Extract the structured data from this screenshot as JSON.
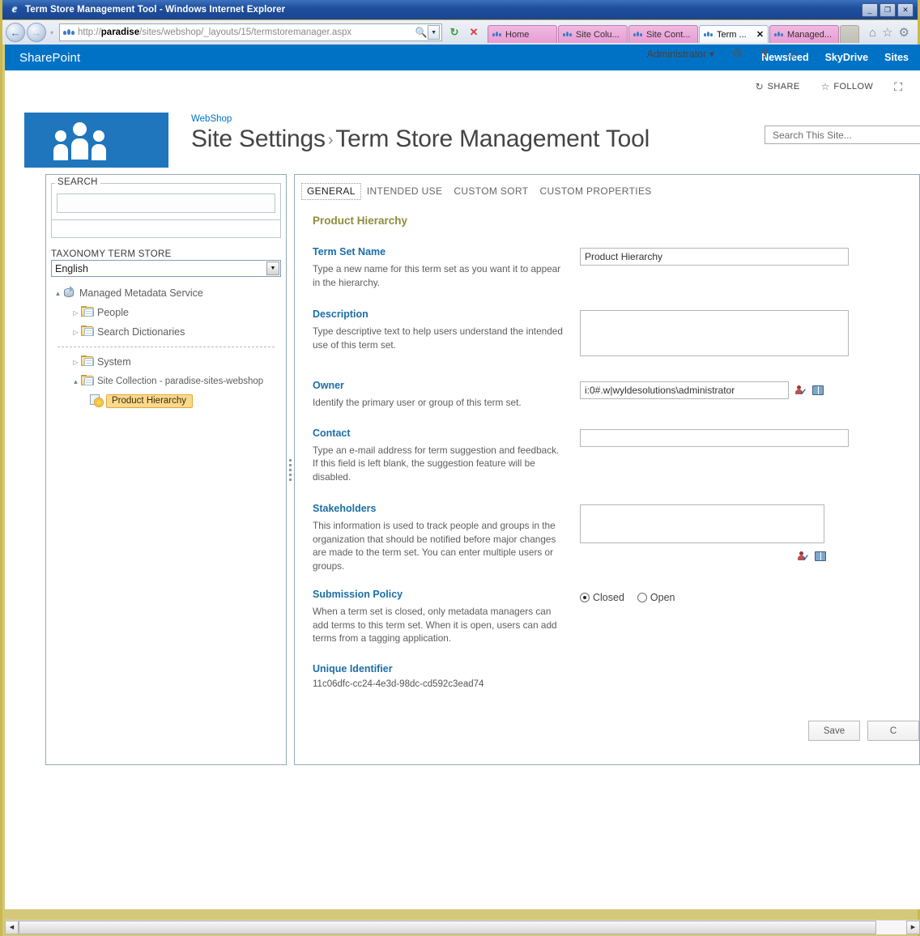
{
  "browser": {
    "window_title": "Term Store Management Tool - Windows Internet Explorer",
    "minimize_glyph": "_",
    "maximize_glyph": "❐",
    "close_glyph": "✕",
    "back_glyph": "←",
    "forward_glyph": "→",
    "history_glyph": "▾",
    "url_prefix": "http://",
    "url_host": "paradise",
    "url_path": "/sites/webshop/_layouts/15/termstoremanager.aspx",
    "search_glyph": "🔍",
    "dropdown_glyph": "▼",
    "refresh_glyph": "↻",
    "stop_glyph": "✕",
    "tabs": [
      {
        "label": "Home",
        "active": false,
        "closable": false
      },
      {
        "label": "Site Colu...",
        "active": false,
        "closable": false
      },
      {
        "label": "Site Cont...",
        "active": false,
        "closable": false
      },
      {
        "label": "Term ...",
        "active": true,
        "closable": true,
        "close_glyph": "✕"
      },
      {
        "label": "Managed...",
        "active": false,
        "closable": false
      }
    ],
    "home_icon": "⌂",
    "favorites_icon": "☆",
    "tools_icon": "⚙"
  },
  "suitebar": {
    "brand": "SharePoint",
    "links": [
      "Newsfeed",
      "SkyDrive",
      "Sites"
    ],
    "user": "Administrator",
    "user_caret": "▾",
    "settings_icon": "⚙",
    "help_icon": "?",
    "feedback_icon": "☺",
    "accent_color": "#0072c6"
  },
  "page_actions": {
    "share_label": "SHARE",
    "share_icon": "↻",
    "follow_label": "FOLLOW",
    "follow_icon": "☆",
    "focus_icon": "⛶"
  },
  "site_header": {
    "breadcrumb": "WebShop",
    "title_primary": "Site Settings",
    "title_separator": "›",
    "title_secondary": "Term Store Management Tool",
    "search_placeholder": "Search This Site..."
  },
  "sidebar": {
    "search_legend": "SEARCH",
    "search_value": "",
    "taxonomy_label": "TAXONOMY TERM STORE",
    "language_value": "English",
    "language_caret": "▼",
    "tree": [
      {
        "label": "Managed Metadata Service",
        "icon": "database-icon",
        "depth": 0,
        "expander": "▲",
        "selected": false
      },
      {
        "label": "People",
        "icon": "folder-icon",
        "depth": 1,
        "expander": "▷",
        "selected": false
      },
      {
        "label": "Search Dictionaries",
        "icon": "folder-icon",
        "depth": 1,
        "expander": "▷",
        "selected": false
      },
      {
        "label": "System",
        "icon": "folder-icon",
        "depth": 1,
        "expander": "▷",
        "selected": false,
        "after_divider": true
      },
      {
        "label": "Site Collection - paradise-sites-webshop",
        "icon": "folder-icon",
        "depth": 1,
        "expander": "▲",
        "selected": false
      },
      {
        "label": "Product Hierarchy",
        "icon": "termset-icon",
        "depth": 2,
        "expander": "",
        "selected": true
      }
    ]
  },
  "content": {
    "tabs": [
      {
        "label": "GENERAL",
        "active": true
      },
      {
        "label": "INTENDED USE",
        "active": false
      },
      {
        "label": "CUSTOM SORT",
        "active": false
      },
      {
        "label": "CUSTOM PROPERTIES",
        "active": false
      }
    ],
    "heading": "Product Hierarchy",
    "fields": [
      {
        "label": "Term Set Name",
        "description": "Type a new name for this term set as you want it to appear in the hierarchy.",
        "control": "text",
        "value": "Product Hierarchy"
      },
      {
        "label": "Description",
        "description": "Type descriptive text to help users understand the intended use of this term set.",
        "control": "textarea",
        "value": ""
      },
      {
        "label": "Owner",
        "description": "Identify the primary user or group of this term set.",
        "control": "people-picker",
        "value": "i:0#.w|wyldesolutions\\administrator"
      },
      {
        "label": "Contact",
        "description": "Type an e-mail address for term suggestion and feedback. If this field is left blank, the suggestion feature will be disabled.",
        "control": "text",
        "value": ""
      },
      {
        "label": "Stakeholders",
        "description": "This information is used to track people and groups in the organization that should be notified before major changes are made to the term set. You can enter multiple users or groups.",
        "control": "people-picker-area",
        "value": ""
      },
      {
        "label": "Submission Policy",
        "description": "When a term set is closed, only metadata managers can add terms to this term set. When it is open, users can add terms from a tagging application.",
        "control": "radio",
        "options": [
          "Closed",
          "Open"
        ],
        "selected": "Closed"
      },
      {
        "label": "Unique Identifier",
        "description": "",
        "control": "static",
        "value": "11c06dfc-cc24-4e3d-98dc-cd592c3ead74"
      }
    ],
    "buttons": [
      {
        "label": "Save"
      },
      {
        "label": "C"
      }
    ]
  },
  "scrollbar": {
    "left_arrow": "◀",
    "right_arrow": "▶"
  }
}
